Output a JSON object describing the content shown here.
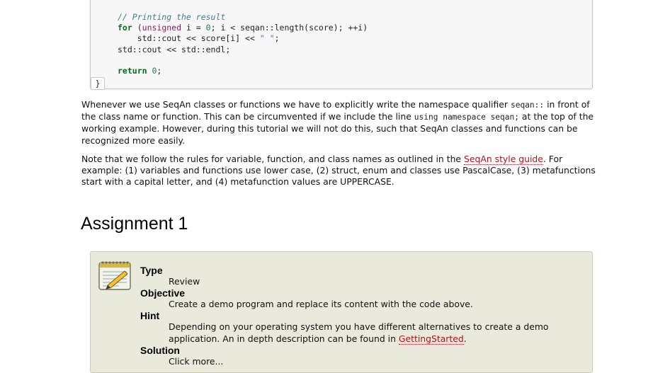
{
  "code": {
    "comment": "// Printing the result",
    "for_kw": "for",
    "unsigned_kw": "unsigned",
    "loop_rest": " i = ",
    "zero": "0",
    "loop_cond": "; i < seqan::length(score); ++i)",
    "line_cout": "std::cout << score[i] << ",
    "space_str": "\" \"",
    "semicolon": ";",
    "line_endl": "std::cout << std::endl;",
    "return_kw": "return",
    "return_val": "0",
    "closing_brace": "}"
  },
  "para1": {
    "t1": "Whenever we use SeqAn classes or functions we have to explicitly write the namespace qualifier ",
    "c1": "seqan::",
    "t2": " in front of the class name or function. This can be circumvented if we include the line ",
    "c2": "using namespace seqan;",
    "t3": " at the top of the working example. However, during this tutorial we will not do this, such that SeqAn classes and functions can be recognized more easily."
  },
  "para2": {
    "t1": "Note that we follow the rules for variable, function, and class names as outlined in the ",
    "link": "SeqAn style guide",
    "t2": ". For example: (1) variables and functions use lower case, (2) struct, enum and classes use PascalCase, (3) metafunctions start with a capital letter, and (4) metafunction values are UPPERCASE."
  },
  "heading": "Assignment 1",
  "assignment": {
    "type_label": "Type",
    "type_value": "Review",
    "objective_label": "Objective",
    "objective_value": "Create a demo program and replace its content with the code above.",
    "hint_label": "Hint",
    "hint_t1": "Depending on your operating system you have different alternatives to create a demo application. An in depth description can be found in ",
    "hint_link": "GettingStarted",
    "hint_t2": ".",
    "solution_label": "Solution",
    "solution_value": "Click more..."
  }
}
